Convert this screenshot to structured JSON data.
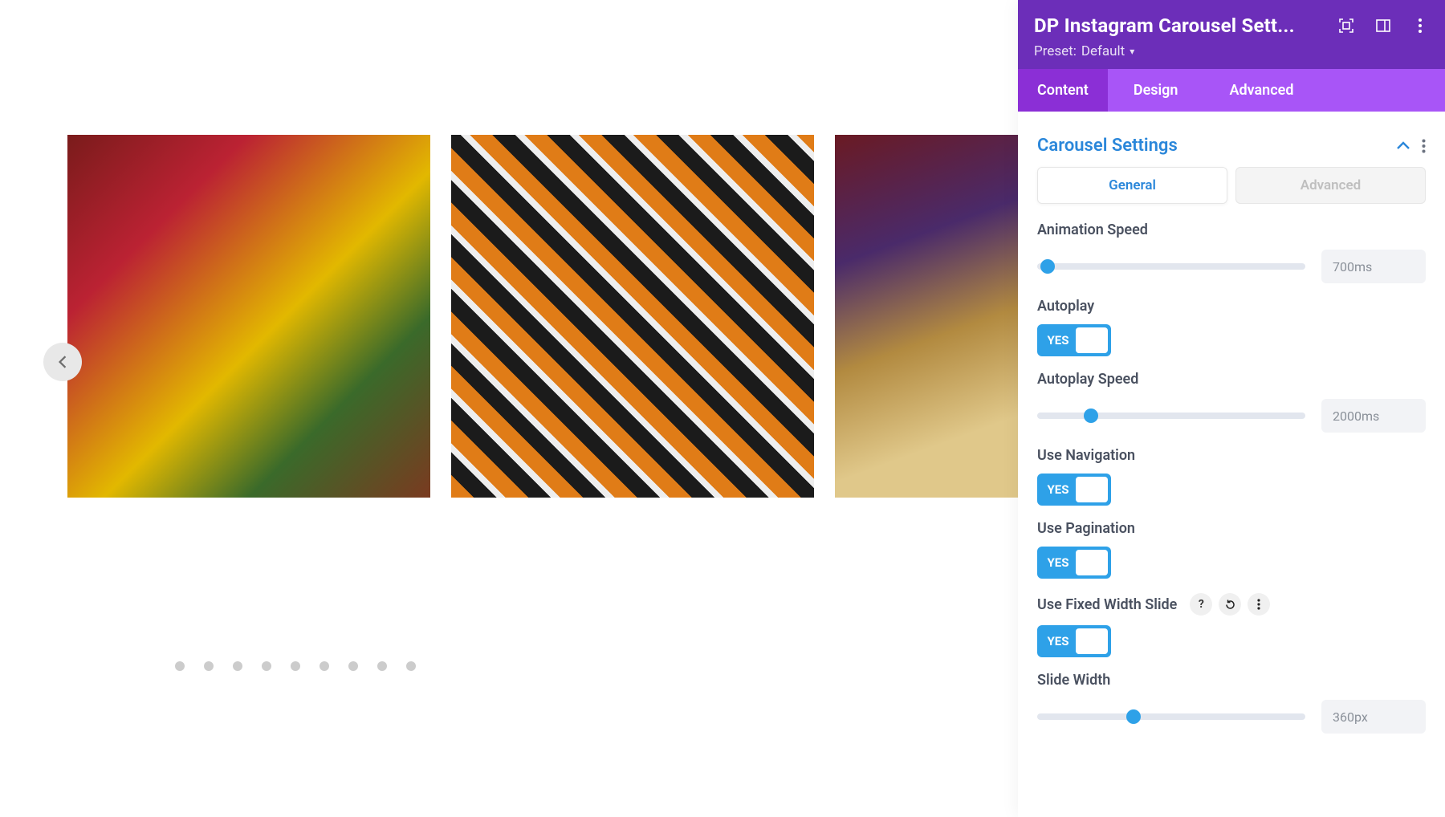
{
  "panel": {
    "title": "DP Instagram Carousel Sett...",
    "preset_label": "Preset:",
    "preset_value": "Default",
    "tabs": {
      "content": "Content",
      "design": "Design",
      "advanced": "Advanced"
    },
    "active_tab": "content"
  },
  "section": {
    "title": "Carousel Settings",
    "sub_tabs": {
      "general": "General",
      "advanced": "Advanced"
    },
    "active_sub": "general"
  },
  "fields": {
    "animation_speed": {
      "label": "Animation Speed",
      "value": "700ms",
      "percent": 4
    },
    "autoplay": {
      "label": "Autoplay",
      "value": "YES"
    },
    "autoplay_speed": {
      "label": "Autoplay Speed",
      "value": "2000ms",
      "percent": 20
    },
    "nav": {
      "label": "Use Navigation",
      "value": "YES"
    },
    "pagination": {
      "label": "Use Pagination",
      "value": "YES"
    },
    "fixed_width": {
      "label": "Use Fixed Width Slide",
      "value": "YES"
    },
    "slide_width": {
      "label": "Slide Width",
      "value": "360px",
      "percent": 36
    }
  },
  "carousel": {
    "dots": 9
  },
  "colors": {
    "head": "#6c2eb9",
    "tabs": "#a855f7",
    "accent": "#2b87da",
    "toggle": "#2ea1e8"
  }
}
